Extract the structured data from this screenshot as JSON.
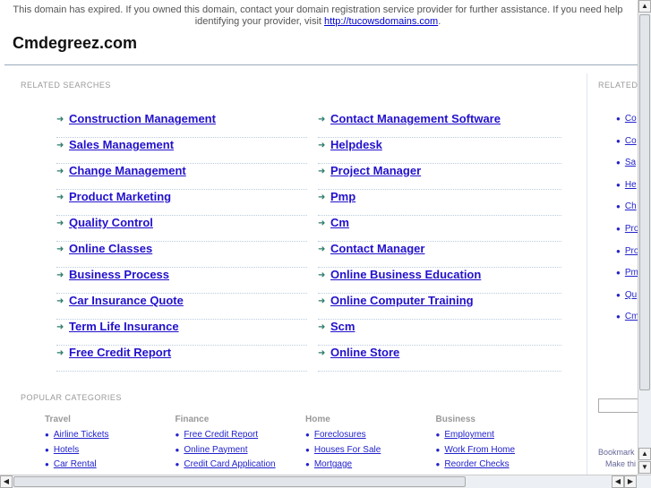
{
  "notice": {
    "text": "This domain has expired. If you owned this domain, contact your domain registration service provider for further assistance. If you need help identifying your provider, visit ",
    "link": "http://tucowsdomains.com",
    "end": "."
  },
  "site_title": "Cmdegreez.com",
  "related": {
    "heading": "RELATED SEARCHES",
    "left": [
      "Construction Management",
      "Sales Management",
      "Change Management",
      "Product Marketing",
      "Quality Control",
      "Online Classes",
      "Business Process",
      "Car Insurance Quote",
      "Term Life Insurance",
      "Free Credit Report"
    ],
    "right": [
      "Contact Management Software",
      "Helpdesk",
      "Project Manager",
      "Pmp",
      "Cm",
      "Contact Manager",
      "Online Business Education",
      "Online Computer Training",
      "Scm",
      "Online Store"
    ]
  },
  "popular": {
    "heading": "POPULAR CATEGORIES",
    "categories": [
      {
        "title": "Travel",
        "links": [
          "Airline Tickets",
          "Hotels",
          "Car Rental"
        ]
      },
      {
        "title": "Finance",
        "links": [
          "Free Credit Report",
          "Online Payment",
          "Credit Card Application"
        ]
      },
      {
        "title": "Home",
        "links": [
          "Foreclosures",
          "Houses For Sale",
          "Mortgage"
        ]
      },
      {
        "title": "Business",
        "links": [
          "Employment",
          "Work From Home",
          "Reorder Checks"
        ]
      }
    ]
  },
  "side": {
    "heading": "RELATED",
    "links": [
      "Co",
      "Co",
      "Sa",
      "He",
      "Ch",
      "Pro",
      "Pro",
      "Pm",
      "Qu",
      "Cm"
    ],
    "bookmark": "Bookmark",
    "make": "Make thi"
  }
}
